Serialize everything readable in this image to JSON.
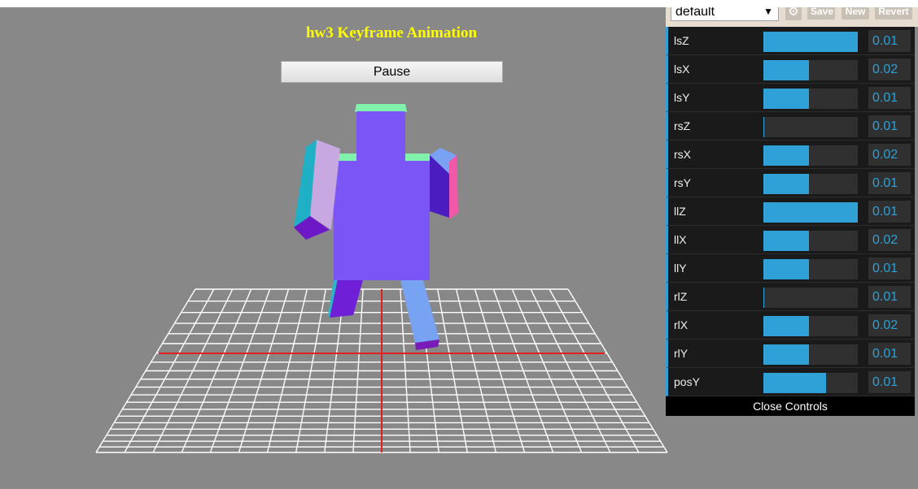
{
  "page": {
    "title": "hw3 Keyframe Animation",
    "pause_label": "Pause"
  },
  "gui": {
    "preset": "default",
    "gear_icon": "gear-icon",
    "save_label": "Save",
    "new_label": "New",
    "revert_label": "Revert",
    "accent_color": "#2fa1d6",
    "controls": [
      {
        "label": "lsZ",
        "value": "0.01",
        "level": 1.0
      },
      {
        "label": "lsX",
        "value": "0.02",
        "level": 0.48
      },
      {
        "label": "lsY",
        "value": "0.01",
        "level": 0.48
      },
      {
        "label": "rsZ",
        "value": "0.01",
        "level": 0.01
      },
      {
        "label": "rsX",
        "value": "0.02",
        "level": 0.48
      },
      {
        "label": "rsY",
        "value": "0.01",
        "level": 0.48
      },
      {
        "label": "llZ",
        "value": "0.01",
        "level": 1.0
      },
      {
        "label": "llX",
        "value": "0.02",
        "level": 0.48
      },
      {
        "label": "llY",
        "value": "0.01",
        "level": 0.48
      },
      {
        "label": "rlZ",
        "value": "0.01",
        "level": 0.01
      },
      {
        "label": "rlX",
        "value": "0.02",
        "level": 0.48
      },
      {
        "label": "rlY",
        "value": "0.01",
        "level": 0.48
      },
      {
        "label": "posY",
        "value": "0.01",
        "level": 0.66
      }
    ],
    "close_label": "Close Controls"
  }
}
